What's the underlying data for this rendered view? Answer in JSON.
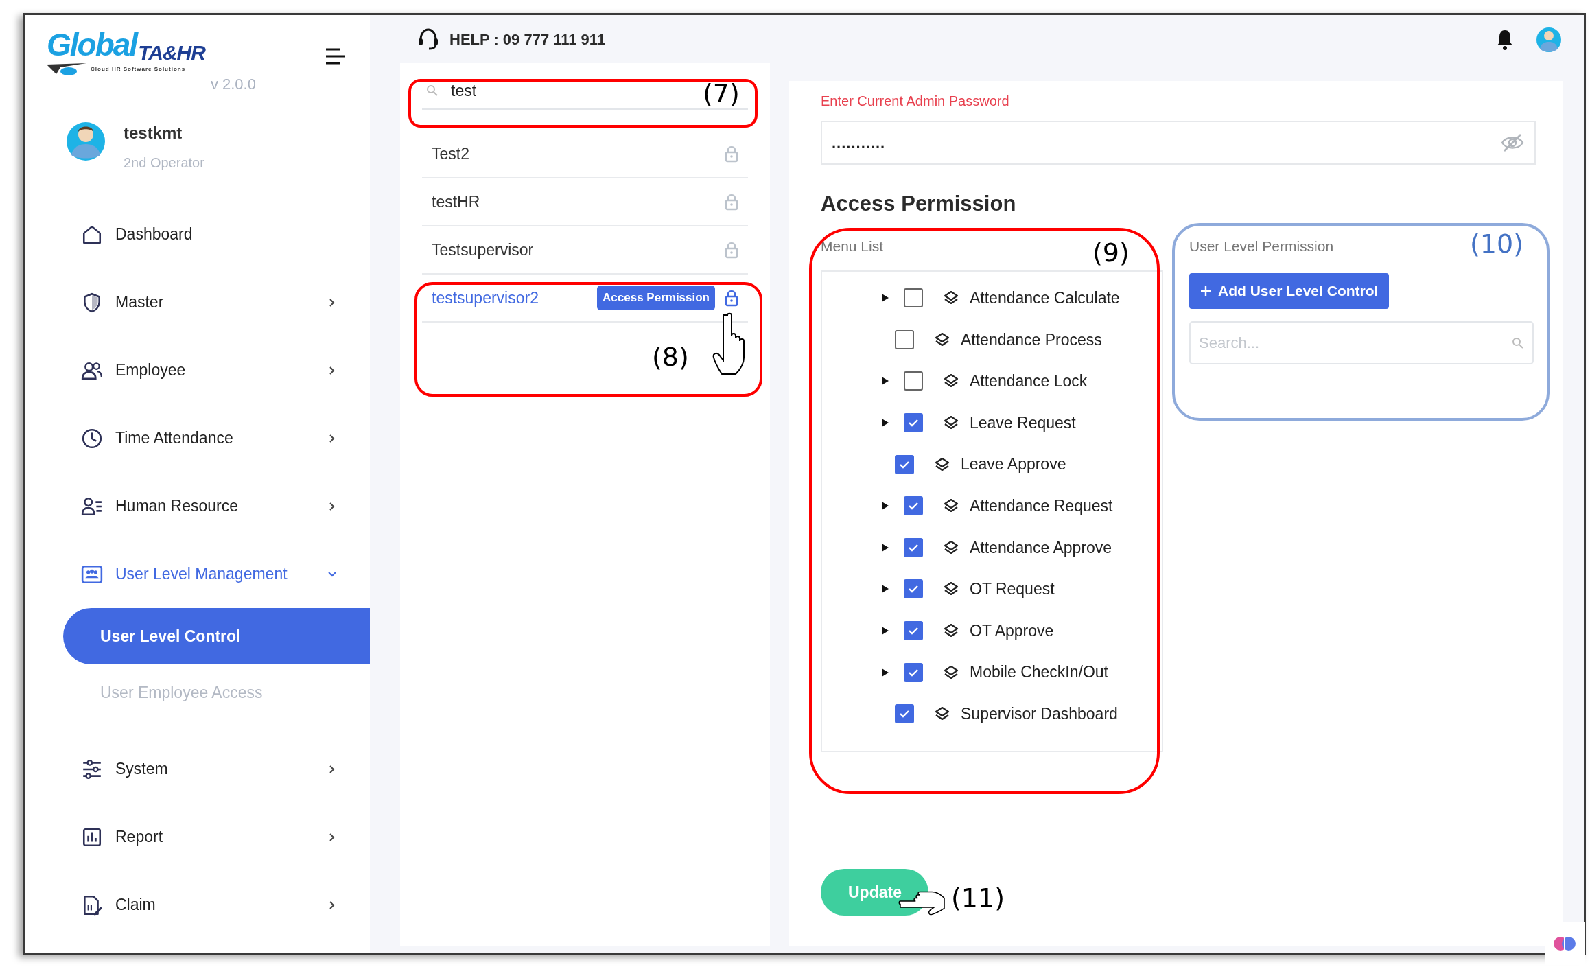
{
  "sidebar": {
    "logo": {
      "word": "Global",
      "suffix": "TA&HR",
      "tagline": "Cloud HR Software Solutions"
    },
    "version": "v 2.0.0",
    "user": {
      "name": "testkmt",
      "role": "2nd Operator"
    },
    "menu": [
      {
        "label": "Dashboard",
        "kind": "link",
        "selected": false
      },
      {
        "label": "Master",
        "kind": "group",
        "selected": false,
        "expanded": false
      },
      {
        "label": "Employee",
        "kind": "group",
        "selected": false,
        "expanded": false
      },
      {
        "label": "Time Attendance",
        "kind": "group",
        "selected": false,
        "expanded": false
      },
      {
        "label": "Human Resource",
        "kind": "group",
        "selected": false,
        "expanded": false
      },
      {
        "label": "User Level Management",
        "kind": "group",
        "selected": true,
        "expanded": true,
        "children": [
          {
            "label": "User Level Control",
            "selected": true
          },
          {
            "label": "User Employee Access",
            "selected": false
          }
        ]
      },
      {
        "label": "System",
        "kind": "group",
        "selected": false,
        "expanded": false
      },
      {
        "label": "Report",
        "kind": "group",
        "selected": false,
        "expanded": false
      },
      {
        "label": "Claim",
        "kind": "group",
        "selected": false,
        "expanded": false
      }
    ]
  },
  "header": {
    "help": "HELP : 09 777 111 911"
  },
  "user_list": {
    "search": {
      "value": "test"
    },
    "rows": [
      {
        "name": "Test2",
        "selected": false
      },
      {
        "name": "testHR",
        "selected": false
      },
      {
        "name": "Testsupervisor",
        "selected": false
      },
      {
        "name": "testsupervisor2",
        "selected": true,
        "badge": "Access Permission"
      }
    ]
  },
  "access": {
    "password_label": "Enter Current Admin Password",
    "password_value": "...........",
    "heading": "Access Permission",
    "menu_list": {
      "label": "Menu List",
      "items": [
        {
          "label": "Attendance Calculate",
          "kind": "branch",
          "checked": false
        },
        {
          "label": "Attendance Process",
          "kind": "leaf",
          "checked": false
        },
        {
          "label": "Attendance Lock",
          "kind": "branch",
          "checked": false
        },
        {
          "label": "Leave Request",
          "kind": "branch",
          "checked": true
        },
        {
          "label": "Leave Approve",
          "kind": "leaf",
          "checked": true
        },
        {
          "label": "Attendance Request",
          "kind": "branch",
          "checked": true
        },
        {
          "label": "Attendance Approve",
          "kind": "branch",
          "checked": true
        },
        {
          "label": "OT Request",
          "kind": "branch",
          "checked": true
        },
        {
          "label": "OT Approve",
          "kind": "branch",
          "checked": true
        },
        {
          "label": "Mobile CheckIn/Out",
          "kind": "branch",
          "checked": true
        },
        {
          "label": "Supervisor Dashboard",
          "kind": "leaf",
          "checked": true
        }
      ]
    },
    "user_level_permission": {
      "label": "User Level Permission",
      "add_button": "Add User Level Control",
      "search": {
        "placeholder": "Search..."
      }
    },
    "update_button": "Update"
  },
  "annotations": {
    "frames": [
      {
        "color": "#ff0000"
      },
      {
        "color": "#ff0000"
      },
      {
        "color": "#ff0000"
      },
      {
        "color": "#8eaadb"
      }
    ],
    "callouts": [
      {
        "label": "(7)",
        "color": "#000000"
      },
      {
        "label": "(8)",
        "color": "#000000"
      },
      {
        "label": "(9)",
        "color": "#000000"
      },
      {
        "label": "(10)",
        "color": "#4472c4"
      },
      {
        "label": "(11)",
        "color": "#000000"
      }
    ]
  }
}
